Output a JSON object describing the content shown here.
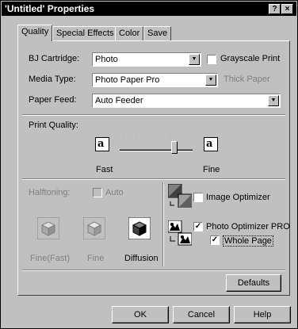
{
  "window": {
    "title": "'Untitled' Properties",
    "help_btn": "?",
    "close_btn": "×"
  },
  "tabs": [
    {
      "label": "Quality",
      "active": true
    },
    {
      "label": "Special Effects",
      "active": false
    },
    {
      "label": "Color",
      "active": false
    },
    {
      "label": "Save",
      "active": false
    }
  ],
  "quality": {
    "cartridge_label": "BJ Cartridge:",
    "cartridge_value": "Photo",
    "grayscale_label": "Grayscale Print",
    "grayscale_checked": false,
    "media_label": "Media Type:",
    "media_value": "Photo Paper Pro",
    "thick_paper_label": "Thick Paper",
    "feed_label": "Paper Feed:",
    "feed_value": "Auto Feeder",
    "print_quality_label": "Print Quality:",
    "quality_fast": "Fast",
    "quality_fine": "Fine",
    "quality_icon_glyph": "a",
    "quality_level": 0.75,
    "halftoning_label": "Halftoning:",
    "auto_label": "Auto",
    "auto_checked": false,
    "halftone_fine_fast": "Fine(Fast)",
    "halftone_fine": "Fine",
    "halftone_diffusion": "Diffusion",
    "halftone_selected": "Diffusion",
    "image_optimizer_label": "Image Optimizer",
    "image_optimizer_checked": false,
    "photo_optimizer_label": "Photo Optimizer PRO",
    "photo_optimizer_checked": true,
    "whole_page_label": "Whole Page",
    "whole_page_checked": true,
    "defaults_btn": "Defaults"
  },
  "footer": {
    "ok": "OK",
    "cancel": "Cancel",
    "help": "Help"
  },
  "colors": {
    "face": "#c0c0c0",
    "titlebar": "#000000",
    "disabled_text": "#808080"
  }
}
